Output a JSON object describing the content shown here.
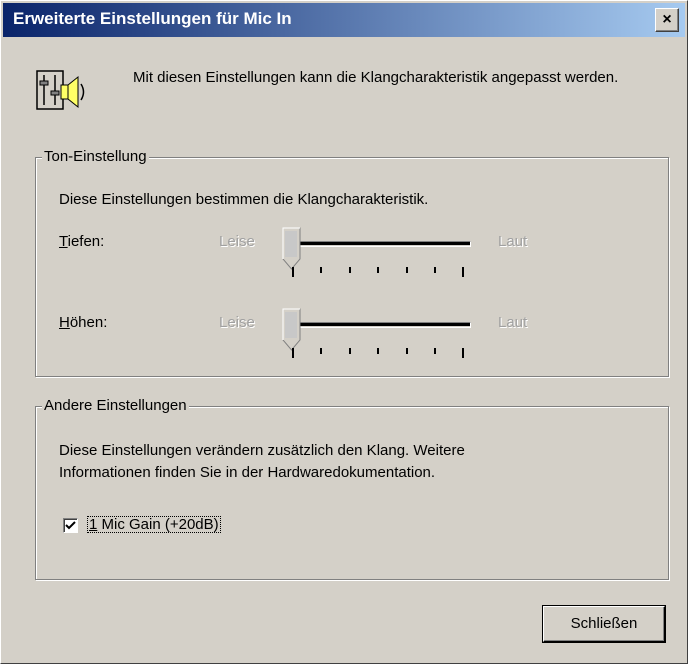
{
  "window": {
    "title": "Erweiterte Einstellungen für Mic In",
    "close_glyph": "×"
  },
  "intro": {
    "icon": "speaker-settings-icon",
    "text": "Mit diesen Einstellungen kann die Klangcharakteristik angepasst werden."
  },
  "tone": {
    "legend": "Ton-Einstellung",
    "description": "Diese Einstellungen bestimmen die Klangcharakteristik.",
    "bass": {
      "label_underlined": "T",
      "label_rest": "iefen:",
      "min_label": "Leise",
      "max_label": "Laut",
      "value": 0,
      "enabled": false
    },
    "treble": {
      "label_underlined": "H",
      "label_rest": "öhen:",
      "min_label": "Leise",
      "max_label": "Laut",
      "value": 0,
      "enabled": false
    }
  },
  "other": {
    "legend": "Andere Einstellungen",
    "description_line1": "Diese Einstellungen verändern zusätzlich den Klang. Weitere",
    "description_line2": "Informationen finden Sie in der Hardwaredokumentation.",
    "mic_gain": {
      "label_underlined": "1",
      "label_rest": " Mic Gain (+20dB)",
      "checked": true
    }
  },
  "buttons": {
    "close_label": "Schließen"
  }
}
